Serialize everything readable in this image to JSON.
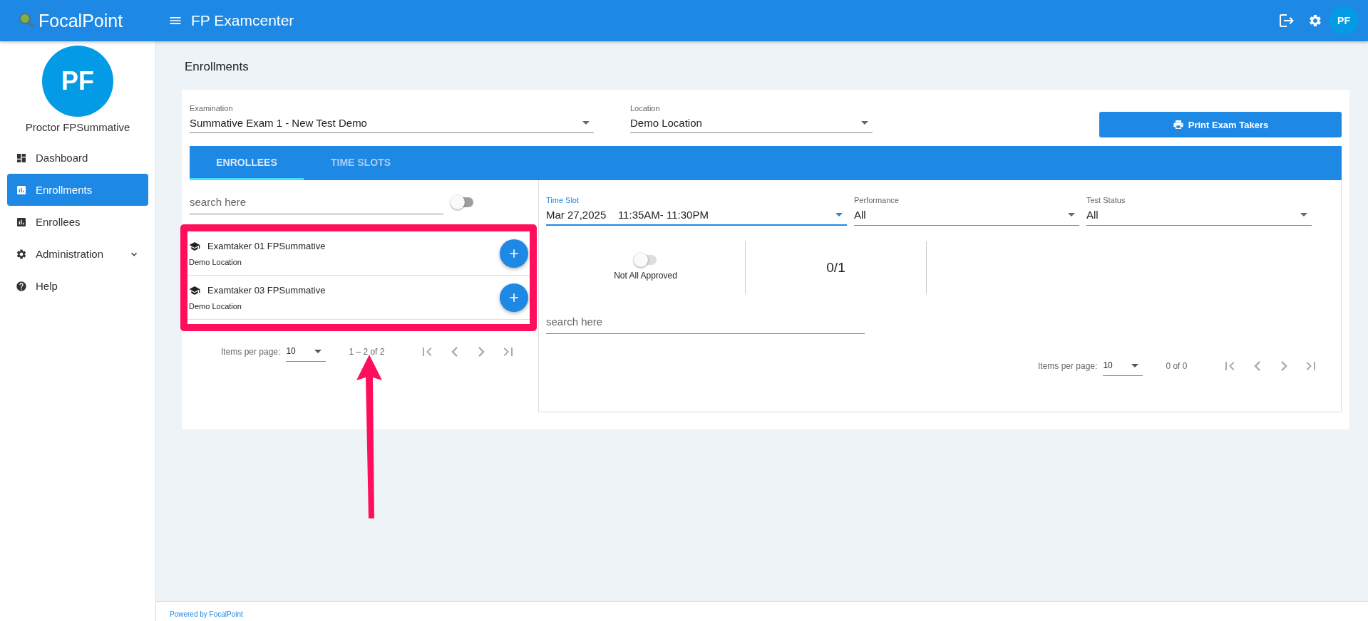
{
  "header": {
    "logo": "FocalPoint",
    "title": "FP Examcenter",
    "avatar": "PF"
  },
  "sidebar": {
    "avatar": "PF",
    "user": "Proctor FPSummative",
    "items": [
      {
        "label": "Dashboard",
        "selected": false,
        "kind": "link"
      },
      {
        "label": "Enrollments",
        "selected": true,
        "kind": "link"
      },
      {
        "label": "Enrollees",
        "selected": false,
        "kind": "link"
      },
      {
        "label": "Administration",
        "selected": false,
        "kind": "group",
        "expanded": false
      },
      {
        "label": "Help",
        "selected": false,
        "kind": "link"
      }
    ]
  },
  "page": {
    "title": "Enrollments"
  },
  "filters": [
    {
      "label": "Examination",
      "value": "Summative Exam 1 - New Test Demo"
    },
    {
      "label": "Location",
      "value": "Demo Location"
    }
  ],
  "print_button": "Print Exam Takers",
  "tabs": [
    {
      "label": "ENROLLEES",
      "selected": true
    },
    {
      "label": "TIME SLOTS",
      "selected": false
    }
  ],
  "enrollees": {
    "search": {
      "placeholder": "search here"
    },
    "toggle": {
      "on": false
    },
    "items": [
      {
        "name": "Examtaker 01 FPSummative",
        "location": "Demo Location"
      },
      {
        "name": "Examtaker 03 FPSummative",
        "location": "Demo Location"
      }
    ],
    "pagination": {
      "label": "Items per page:",
      "page_size": "10",
      "range": "1 – 2 of 2"
    }
  },
  "time_slot_panel": {
    "filters": [
      {
        "label": "Time Slot",
        "value": "Mar 27,2025    11:35AM- 11:30PM",
        "focused": true
      },
      {
        "label": "Performance",
        "value": "All",
        "focused": false
      },
      {
        "label": "Test Status",
        "value": "All",
        "focused": false
      }
    ],
    "approval": {
      "on": false,
      "label": "Not All Approved"
    },
    "count": "0/1",
    "search": {
      "placeholder": "search here"
    },
    "pagination": {
      "label": "Items per page:",
      "page_size": "10",
      "range": "0 of 0"
    }
  },
  "footer": {
    "text": "Powered by FocalPoint"
  }
}
